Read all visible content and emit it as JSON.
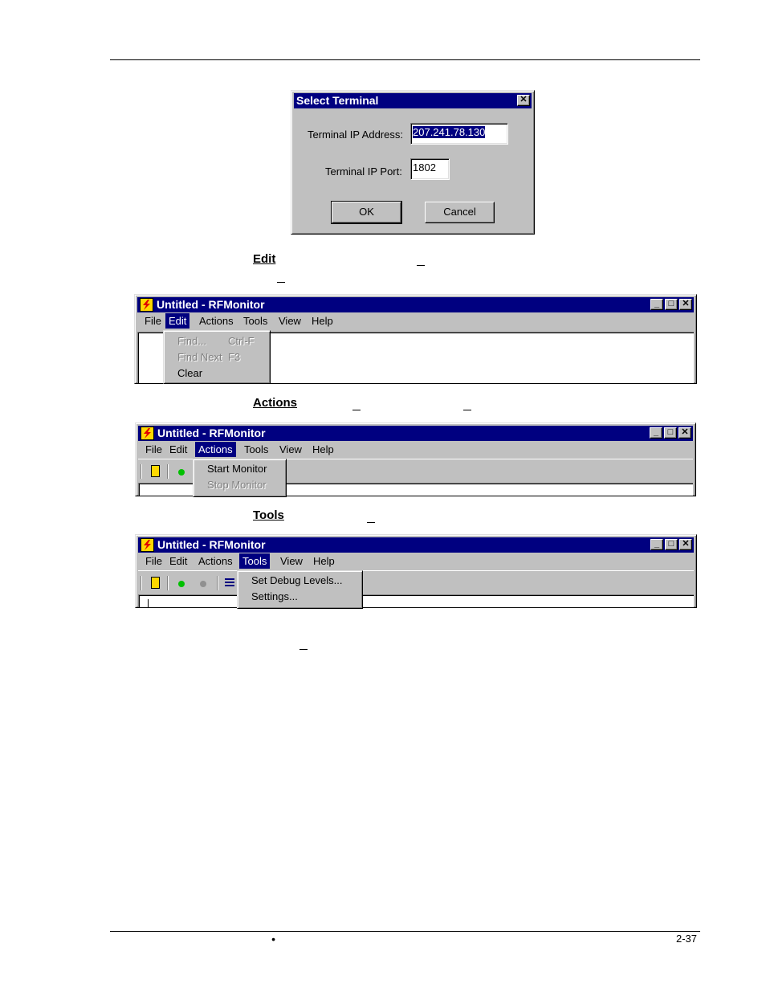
{
  "dialog": {
    "title": "Select Terminal",
    "ip_label": "Terminal IP Address:",
    "ip_value": "207.241.78.130",
    "port_label": "Terminal IP Port:",
    "port_value": "1802",
    "ok": "OK",
    "cancel": "Cancel"
  },
  "app_title": "Untitled - RFMonitor",
  "menu": {
    "file": "File",
    "edit": "Edit",
    "actions": "Actions",
    "tools": "Tools",
    "view": "View",
    "help": "Help"
  },
  "edit_menu": {
    "find": "Find...",
    "find_accel": "Ctrl-F",
    "find_next": "Find Next",
    "find_next_accel": "F3",
    "clear": "Clear"
  },
  "actions_menu": {
    "start": "Start Monitor",
    "stop": "Stop Monitor"
  },
  "tools_menu": {
    "debug": "Set Debug Levels...",
    "settings": "Settings..."
  },
  "headings": {
    "edit": "Edit",
    "actions": "Actions",
    "tools": "Tools"
  },
  "footer": {
    "page": "2-37",
    "bullet": "•"
  },
  "colors": {
    "titlebar": "#000080",
    "face": "#c0c0c0",
    "highlight": "#000080",
    "green": "#00c000"
  }
}
